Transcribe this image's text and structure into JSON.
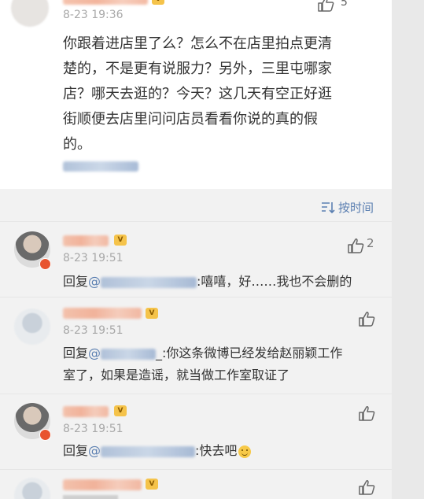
{
  "post": {
    "time": "8-23 19:36",
    "like_count": "5",
    "text_lines": [
      "你跟着进店里了么？怎么不在店里拍点更清",
      "楚的，不是更有说服力？另外，三里屯哪家",
      "店？哪天去逛的？今天？这几天有空正好逛",
      "街顺便去店里问问店员看看你说的真的假",
      "的。"
    ]
  },
  "sort": {
    "label": "按时间"
  },
  "comments": [
    {
      "time": "8-23 19:51",
      "like_count": "2",
      "reply_prefix": "回复",
      "at": "@",
      "text_line1": ":嘻嘻，好……我也不会删的",
      "text_line2": ""
    },
    {
      "time": "8-23 19:51",
      "like_count": "",
      "reply_prefix": "回复",
      "at": "@",
      "text_line1": "_:你这条微博已经发给赵丽颖工作",
      "text_line2": "室了，如果是造谣，就当做工作室取证了"
    },
    {
      "time": "8-23 19:51",
      "like_count": "",
      "reply_prefix": "回复",
      "at": "@",
      "text_line1": ":快去吧",
      "text_line2": ""
    }
  ],
  "colors": {
    "link": "#5b7fb1",
    "time": "#a8a8a8",
    "text": "#333333"
  },
  "icons": [
    "thumbs-up-icon",
    "sort-icon",
    "vip-badge-icon",
    "smile-emoji-icon",
    "verified-badge-icon"
  ]
}
